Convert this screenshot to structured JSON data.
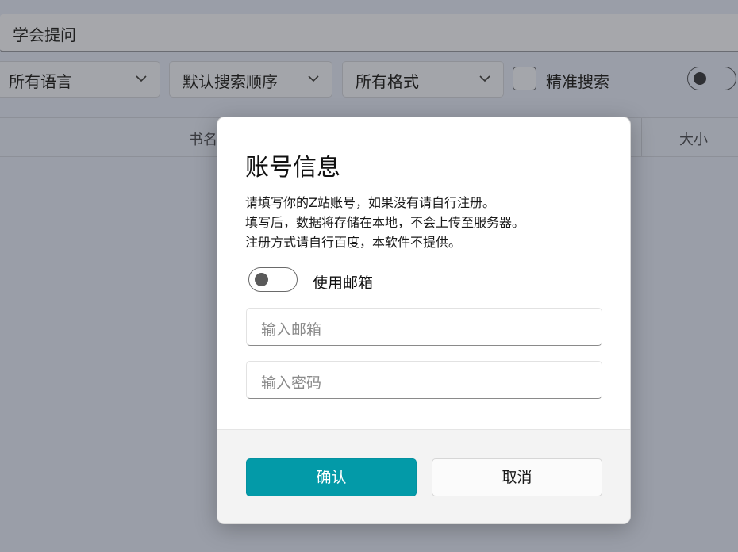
{
  "search": {
    "value": "学会提问"
  },
  "filters": {
    "language": "所有语言",
    "order": "默认搜索顺序",
    "format": "所有格式",
    "exact_search_label": "精准搜索"
  },
  "table": {
    "columns": [
      "书名",
      "大小"
    ]
  },
  "dialog": {
    "title": "账号信息",
    "description": [
      "请填写你的Z站账号，如果没有请自行注册。",
      "填写后，数据将存储在本地，不会上传至服务器。",
      "注册方式请自行百度，本软件不提供。"
    ],
    "use_email_label": "使用邮箱",
    "email_placeholder": "输入邮箱",
    "password_placeholder": "输入密码",
    "confirm_label": "确认",
    "cancel_label": "取消"
  },
  "colors": {
    "accent": "#039aa8",
    "overlay_background": "#9a9ea8"
  }
}
